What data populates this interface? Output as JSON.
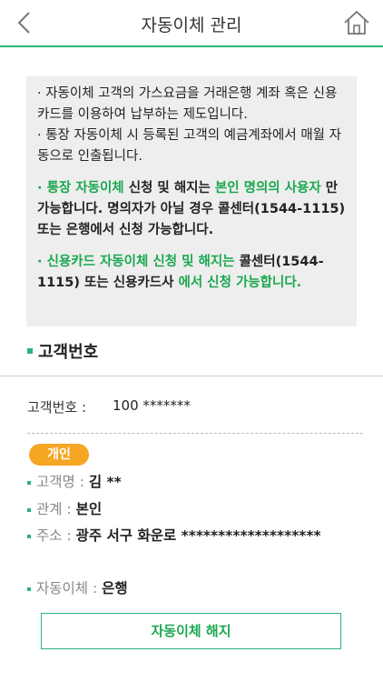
{
  "header": {
    "title": "자동이체 관리"
  },
  "notice": {
    "line1": "· 자동이체 고객의 가스요금을 거래은행 계좌 혹은 신용카드를 이용하여 납부하는 제도입니다.",
    "line2": "· 통장 자동이체 시 등록된 고객의 예금계좌에서 매월 자동으로 인출됩니다.",
    "p3_a": "통장 자동이체",
    "p3_b": " 신청 및 해지는 ",
    "p3_c": "본인 명의의 사용자",
    "p3_d": " 만 가능합니다. 명의자가 아닐 경우 콜센터(1544-1115) 또는 은행에서 신청 가능합니다.",
    "p4_a": "신용카드 자동이체 신청 및 해지는",
    "p4_b": " 콜센터(1544-1115) 또는 신용카드사 ",
    "p4_c": "에서 신청 가능합니다."
  },
  "section": {
    "title": "고객번호"
  },
  "customer": {
    "label": "고객번호 :",
    "value": "100 *******"
  },
  "badge": "개인",
  "details": {
    "name_label": "고객명 : ",
    "name_value": "김 **",
    "relation_label": "관계 : ",
    "relation_value": "본인",
    "address_label": "주소 : ",
    "address_value": "광주 서구 화운로 *******************",
    "autopay_label": "자동이체 : ",
    "autopay_value": "은행"
  },
  "button": {
    "cancel_label": "자동이체 해지"
  },
  "colors": {
    "accent": "#2db37a",
    "green_text": "#1aa84f",
    "badge": "#f5a623"
  }
}
